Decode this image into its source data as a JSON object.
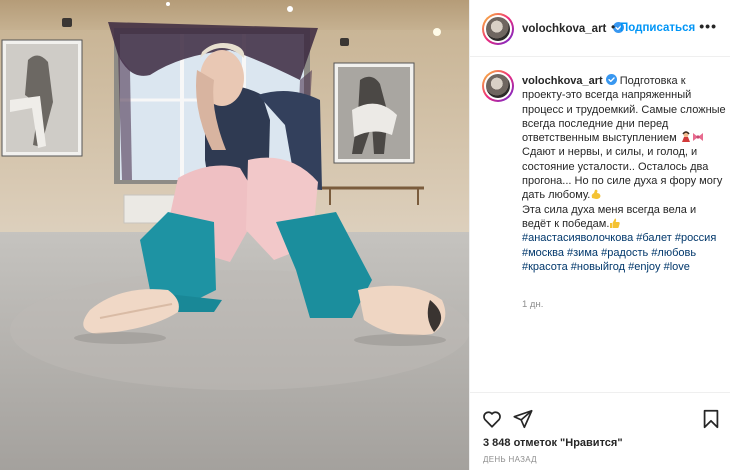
{
  "post": {
    "username": "volochkova_art",
    "follow_label": "Подписаться",
    "more_label": "•••",
    "header_separator": "•",
    "caption": {
      "lines": [
        "Подготовка к проекту-это всегда напряженный процесс и трудоемкий. Самые сложные всегда последние дни перед ответственным выступлением",
        "Сдают и нервы, и силы, и голод, и состояние усталости.. Осталось два прогона... Но по силе духа я фору могу дать любому.",
        "Эта сила духа меня всегда вела и ведёт к победам."
      ],
      "hashtags": [
        "#анастасияволочкова",
        "#балет",
        "#россия",
        "#москва",
        "#зима",
        "#радость",
        "#любовь",
        "#красота",
        "#новыйгод",
        "#enjoy",
        "#love"
      ]
    },
    "age": "1 дн.",
    "likes": "3 848 отметок \"Нравится\"",
    "timestamp": "ДЕНЬ НАЗАД",
    "icons": {
      "verified": "verified-badge-icon",
      "like": "heart-icon",
      "share": "paper-plane-icon",
      "save": "bookmark-icon"
    },
    "colors": {
      "accent": "#0095f6",
      "hashtag": "#00376b",
      "muted": "#8e8e8e"
    }
  }
}
